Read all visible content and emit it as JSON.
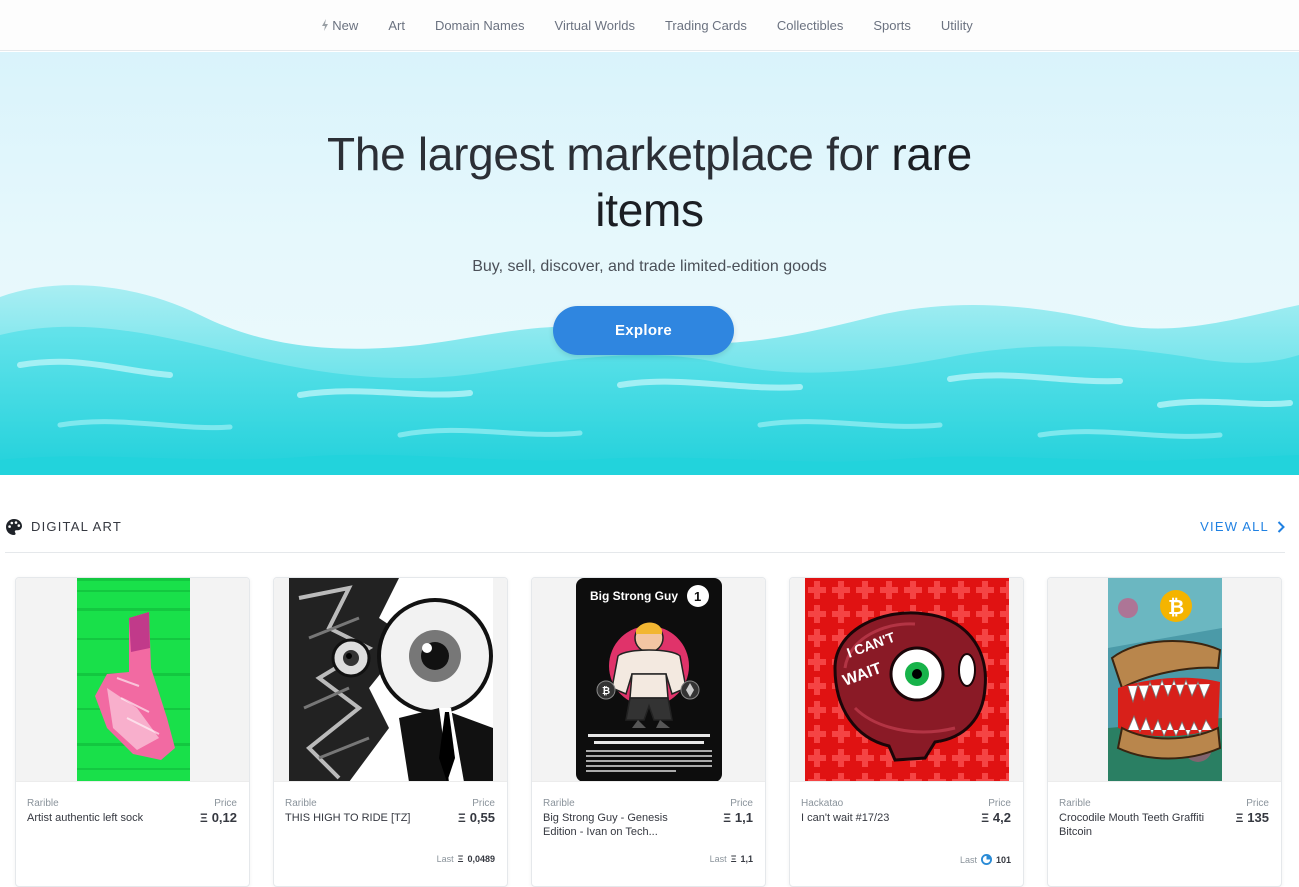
{
  "nav": {
    "items": [
      {
        "label": "New",
        "icon": "bolt-icon"
      },
      {
        "label": "Art"
      },
      {
        "label": "Domain Names"
      },
      {
        "label": "Virtual Worlds"
      },
      {
        "label": "Trading Cards"
      },
      {
        "label": "Collectibles"
      },
      {
        "label": "Sports"
      },
      {
        "label": "Utility"
      }
    ]
  },
  "hero": {
    "title_part1": "The largest marketplace for",
    "title_part2": "rare",
    "title_part3": "items",
    "subtitle": "Buy, sell, discover, and trade limited-edition goods",
    "explore_label": "Explore"
  },
  "section": {
    "title": "DIGITAL ART",
    "icon": "palette-icon",
    "view_all_label": "VIEW ALL"
  },
  "cards": [
    {
      "collection": "Rarible",
      "name": "Artist authentic left sock",
      "price_label": "Price",
      "price": "0,12",
      "currency": "Ξ"
    },
    {
      "collection": "Rarible",
      "name": "THIS HIGH TO RIDE [TZ]",
      "price_label": "Price",
      "price": "0,55",
      "currency": "Ξ",
      "last_label": "Last",
      "last_value": "0,0489",
      "last_currency": "Ξ"
    },
    {
      "collection": "Rarible",
      "name": "Big Strong Guy - Genesis Edition - Ivan on Tech...",
      "price_label": "Price",
      "price": "1,1",
      "currency": "Ξ",
      "last_label": "Last",
      "last_value": "1,1",
      "last_currency": "Ξ",
      "art_title": "Big Strong Guy",
      "art_number": "1"
    },
    {
      "collection": "Hackatao",
      "name": "I can't wait #17/23",
      "price_label": "Price",
      "price": "4,2",
      "currency": "Ξ",
      "last_label": "Last",
      "last_value": "101",
      "last_currency": "token"
    },
    {
      "collection": "Rarible",
      "name": "Crocodile Mouth Teeth Graffiti Bitcoin",
      "price_label": "Price",
      "price": "135",
      "currency": "Ξ"
    }
  ],
  "colors": {
    "accent": "#2081e2",
    "button": "#2f86e0",
    "wave_light": "#7fe3ec",
    "wave_dark": "#22d3dc"
  }
}
